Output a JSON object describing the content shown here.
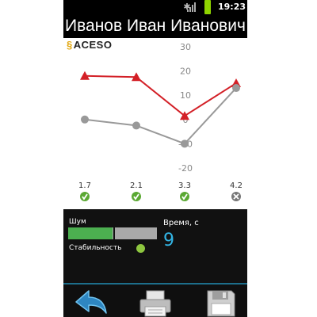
{
  "status_bar": {
    "time": "19:23",
    "icons": [
      "bluetooth-icon",
      "signal-icon",
      "battery-icon"
    ],
    "battery_color": "#8fd400"
  },
  "patient": {
    "name": "Иванов Иван Иванович"
  },
  "logo": {
    "text": "ACESO",
    "mark": "§"
  },
  "chart_data": {
    "type": "line",
    "x": [
      "1.7",
      "2.1",
      "3.3",
      "4.2"
    ],
    "ylim": [
      -22,
      32
    ],
    "y_ticks": [
      30,
      20,
      10,
      0,
      -10,
      -20
    ],
    "grid": false,
    "series": [
      {
        "color": "#d32027",
        "marker": "triangle",
        "values": [
          18,
          17.5,
          1.5,
          15
        ]
      },
      {
        "color": "#999999",
        "marker": "circle",
        "values": [
          0,
          -2.5,
          -10,
          13
        ]
      }
    ],
    "status": [
      "ok",
      "ok",
      "ok",
      "fail"
    ],
    "status_colors": {
      "ok": "#5aa832",
      "fail": "#777777"
    }
  },
  "metrics": {
    "noise_label": "Шум",
    "noise_level": 0.5,
    "noise_color": "#4caf50",
    "stability_label": "Стабильность",
    "stability_color": "#8dc63f",
    "time_label": "Время, с",
    "time_value": "9",
    "time_color": "#33b5e5"
  },
  "nav": {
    "buttons": [
      "back-arrow-icon",
      "print-icon",
      "save-floppy-icon"
    ]
  }
}
